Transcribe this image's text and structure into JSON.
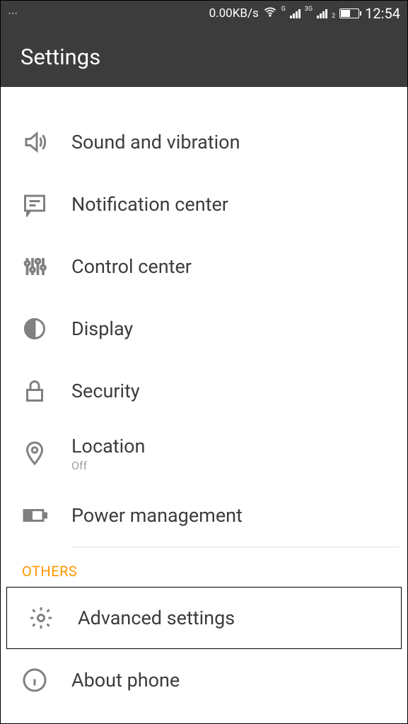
{
  "status_bar": {
    "network_speed": "0.00KB/s",
    "signal1_label": "G",
    "signal2_label": "3G",
    "signal2_sub": "2",
    "time": "12:54"
  },
  "app_bar": {
    "title": "Settings"
  },
  "items": {
    "sound": {
      "label": "Sound and vibration"
    },
    "notification": {
      "label": "Notification center"
    },
    "control": {
      "label": "Control center"
    },
    "display": {
      "label": "Display"
    },
    "security": {
      "label": "Security"
    },
    "location": {
      "label": "Location",
      "sub": "Off"
    },
    "power": {
      "label": "Power management"
    },
    "advanced": {
      "label": "Advanced settings"
    },
    "about": {
      "label": "About phone"
    }
  },
  "section": {
    "others": "OTHERS"
  }
}
